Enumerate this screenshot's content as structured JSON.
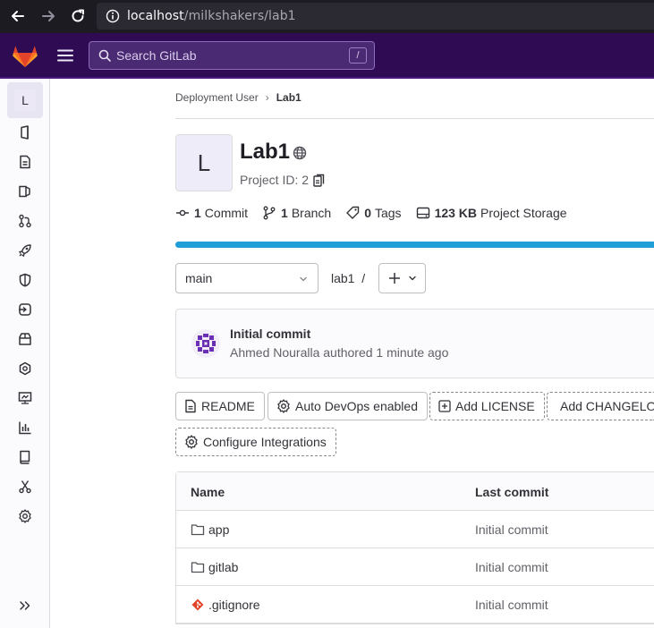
{
  "browser": {
    "url_host": "localhost",
    "url_path": "/milkshakers/lab1"
  },
  "header": {
    "search_placeholder": "Search GitLab",
    "search_shortcut": "/"
  },
  "sidebar": {
    "project_letter": "L",
    "icons": [
      "project-overview-icon",
      "repository-icon",
      "issues-icon",
      "merge-requests-icon",
      "ci-cd-rocket-icon",
      "security-shield-icon",
      "deployments-icon",
      "packages-icon",
      "infrastructure-icon",
      "monitor-icon",
      "analytics-icon",
      "wiki-icon",
      "snippets-icon",
      "settings-gear-icon"
    ]
  },
  "breadcrumb": {
    "parent": "Deployment User",
    "current": "Lab1"
  },
  "project": {
    "avatar_letter": "L",
    "name": "Lab1",
    "id_label": "Project ID: 2"
  },
  "stats": {
    "commits_count": "1",
    "commits_label": "Commit",
    "branches_count": "1",
    "branches_label": "Branch",
    "tags_count": "0",
    "tags_label": "Tags",
    "storage_value": "123 KB",
    "storage_label": "Project Storage"
  },
  "repo": {
    "branch": "main",
    "path": "lab1",
    "path_sep": "/"
  },
  "commit": {
    "title": "Initial commit",
    "meta": "Ahmed Nouralla authored 1 minute ago"
  },
  "actions": {
    "readme": "README",
    "auto_devops": "Auto DevOps enabled",
    "add_license": "Add LICENSE",
    "add_changelog": "Add CHANGELOG",
    "configure_integrations": "Configure Integrations"
  },
  "files": {
    "headers": {
      "name": "Name",
      "last_commit": "Last commit"
    },
    "rows": [
      {
        "name": "app",
        "type": "folder",
        "last_commit": "Initial commit"
      },
      {
        "name": "gitlab",
        "type": "folder",
        "last_commit": "Initial commit"
      },
      {
        "name": ".gitignore",
        "type": "git-file",
        "last_commit": "Initial commit"
      }
    ]
  },
  "colors": {
    "header_bg": "#2f0b54",
    "progress": "#1f9ed8",
    "avatar_bg": "#efecfa"
  }
}
